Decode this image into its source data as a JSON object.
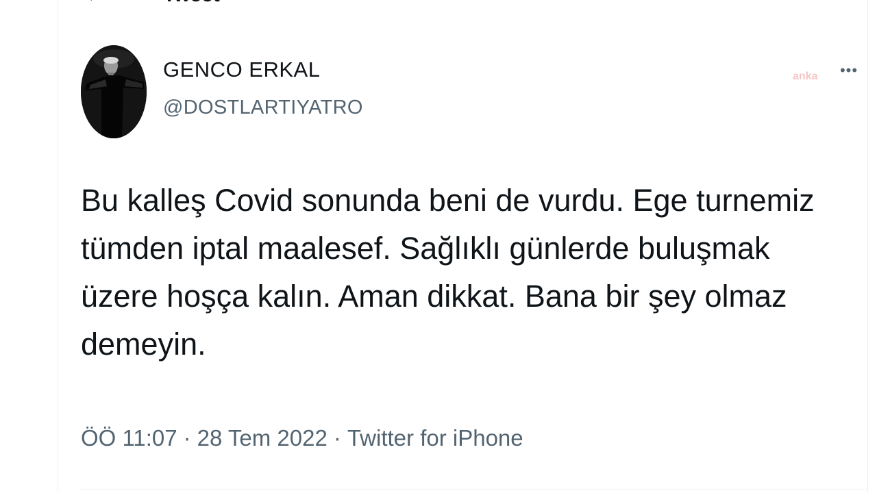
{
  "header": {
    "back_icon": "arrow-left-icon",
    "back_glyph": "←",
    "title": "Tweet"
  },
  "author": {
    "display_name": "GENCO ERKAL",
    "handle": "@DOSTLARTIYATRO",
    "avatar_icon": "profile-photo"
  },
  "watermark": {
    "text": "anka"
  },
  "more": {
    "icon": "more-horizontal-icon",
    "glyph": "•••"
  },
  "tweet": {
    "text": "Bu kalleş Covid sonunda beni de vurdu. Ege turnemiz tümden iptal maalesef. Sağlıklı günlerde buluşmak üzere hoşça kalın. Aman dikkat. Bana bir şey olmaz demeyin.",
    "time": "ÖÖ 11:07",
    "separator": "·",
    "date": "28 Tem 2022",
    "source": "Twitter for iPhone"
  },
  "colors": {
    "text_primary": "#0f1419",
    "text_secondary": "#536471",
    "divider": "#eff3f4",
    "watermark": "#f4b9b6"
  }
}
